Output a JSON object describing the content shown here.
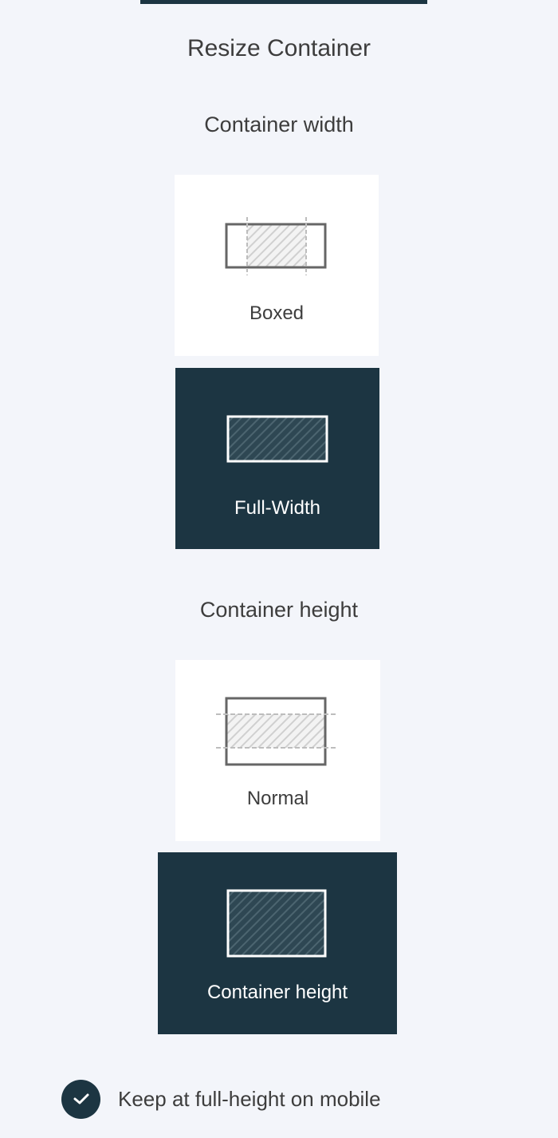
{
  "panel": {
    "title": "Resize Container"
  },
  "width_section": {
    "label": "Container width",
    "selected": "Full-Width",
    "options": [
      {
        "label": "Boxed",
        "icon": "boxed-width-icon",
        "selected": false
      },
      {
        "label": "Full-Width",
        "icon": "full-width-icon",
        "selected": true
      }
    ]
  },
  "height_section": {
    "label": "Container height",
    "selected": "Container height",
    "options": [
      {
        "label": "Normal",
        "icon": "normal-height-icon",
        "selected": false
      },
      {
        "label": "Container height",
        "icon": "container-height-icon",
        "selected": true
      }
    ]
  },
  "mobile_option": {
    "label": "Keep at full-height on mobile",
    "checked": true,
    "icon": "checkmark-icon"
  },
  "colors": {
    "background": "#f3f5fa",
    "selected_background": "#1c3542",
    "unselected_background": "#ffffff",
    "text": "#3d3d3d"
  }
}
